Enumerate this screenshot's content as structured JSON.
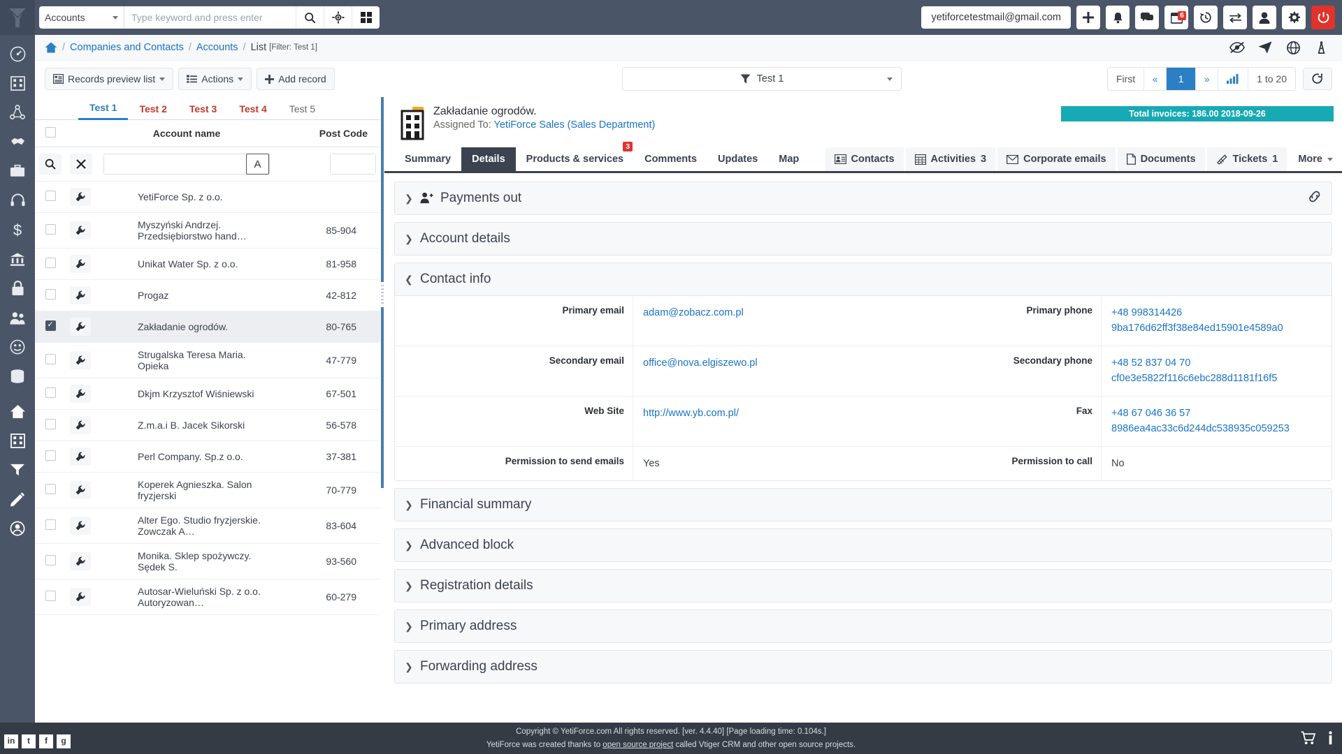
{
  "topbar": {
    "module_select": "Accounts",
    "search_placeholder": "Type keyword and press enter",
    "user_email": "yetiforcetestmail@gmail.com",
    "calendar_badge": "6",
    "icons": [
      "search-icon",
      "crosshair-icon",
      "grid-icon",
      "plus-icon",
      "bell-icon",
      "chat-icon",
      "calendar-icon",
      "history-icon",
      "transfer-icon",
      "user-icon",
      "gear-icon",
      "power-icon"
    ]
  },
  "breadcrumb": {
    "home": "⌂",
    "items": [
      "Companies and Contacts",
      "Accounts"
    ],
    "current": "List",
    "filter": "[Filter: Test 1]",
    "actions": [
      "eye-slash-icon",
      "paper-plane-icon",
      "globe-icon",
      "tower-icon"
    ]
  },
  "toolbar": {
    "records_preview": "Records preview list",
    "actions": "Actions",
    "add_record": "Add record",
    "filter_value": "Test 1",
    "pager": {
      "first": "First",
      "prev": "«",
      "page": "1",
      "next": "»",
      "chart_icon": "bar-chart-icon",
      "range": "1 to 20",
      "refresh": "↺"
    }
  },
  "list": {
    "tabs": [
      {
        "label": "Test 1",
        "active": true
      },
      {
        "label": "Test 2",
        "active": false
      },
      {
        "label": "Test 3",
        "active": false
      },
      {
        "label": "Test 4",
        "active": false
      },
      {
        "label": "Test 5",
        "active": false
      }
    ],
    "columns": [
      "Account name",
      "Post Code"
    ],
    "search_row": {
      "name_value": "",
      "code_value": "",
      "alpha_btn": "A"
    },
    "rows": [
      {
        "name": "YetiForce Sp. z o.o.",
        "code": "",
        "selected": false
      },
      {
        "name": "Myszyński Andrzej. Przedsiębiorstwo hand…",
        "code": "85-904",
        "selected": false
      },
      {
        "name": "Unikat Water Sp. z o.o.",
        "code": "81-958",
        "selected": false
      },
      {
        "name": "Progaz",
        "code": "42-812",
        "selected": false
      },
      {
        "name": "Zakładanie ogrodów.",
        "code": "80-765",
        "selected": true
      },
      {
        "name": "Strugalska Teresa Maria. Opieka",
        "code": "47-779",
        "selected": false
      },
      {
        "name": "Dkjm Krzysztof Wiśniewski",
        "code": "67-501",
        "selected": false
      },
      {
        "name": "Z.m.a.i B. Jacek Sikorski",
        "code": "56-578",
        "selected": false
      },
      {
        "name": "Perl Company. Sp.z o.o.",
        "code": "37-381",
        "selected": false
      },
      {
        "name": "Koperek Agnieszka. Salon fryzjerski",
        "code": "70-779",
        "selected": false
      },
      {
        "name": "Alter Ego. Studio fryzjerskie. Zowczak A…",
        "code": "83-604",
        "selected": false
      },
      {
        "name": "Monika. Sklep spożywczy. Sędek S.",
        "code": "93-560",
        "selected": false
      },
      {
        "name": "Autosar-Wieluński Sp. z o.o. Autoryzowan…",
        "code": "60-279",
        "selected": false
      }
    ]
  },
  "record": {
    "title": "Zakładanie ogrodów.",
    "assigned_label": "Assigned To:",
    "assigned_to": "YetiForce Sales (Sales Department)",
    "invoice_badge": "Total invoices: 186.00 2018-09-26",
    "tabs_left": [
      {
        "label": "Summary",
        "active": false,
        "badge": ""
      },
      {
        "label": "Details",
        "active": true,
        "badge": ""
      },
      {
        "label": "Products & services",
        "active": false,
        "badge": "3"
      },
      {
        "label": "Comments",
        "active": false,
        "badge": ""
      },
      {
        "label": "Updates",
        "active": false,
        "badge": ""
      },
      {
        "label": "Map",
        "active": false,
        "badge": ""
      }
    ],
    "tabs_right": [
      {
        "label": "Contacts",
        "icon": "contact-card-icon",
        "badge": ""
      },
      {
        "label": "Activities",
        "icon": "calendar-grid-icon",
        "badge": "3"
      },
      {
        "label": "Corporate emails",
        "icon": "envelope-icon",
        "badge": ""
      },
      {
        "label": "Documents",
        "icon": "document-icon",
        "badge": ""
      },
      {
        "label": "Tickets",
        "icon": "ticket-icon",
        "badge": "1"
      },
      {
        "label": "More",
        "icon": "caret-down-icon",
        "badge": ""
      }
    ]
  },
  "blocks": [
    {
      "title": "Payments out",
      "expanded": false,
      "has_icon": true,
      "has_link": true
    },
    {
      "title": "Account details",
      "expanded": false,
      "has_icon": false,
      "has_link": false
    },
    {
      "title": "Contact info",
      "expanded": true,
      "has_icon": false,
      "has_link": false
    },
    {
      "title": "Financial summary",
      "expanded": false,
      "has_icon": false,
      "has_link": false
    },
    {
      "title": "Advanced block",
      "expanded": false,
      "has_icon": false,
      "has_link": false
    },
    {
      "title": "Registration details",
      "expanded": false,
      "has_icon": false,
      "has_link": false
    },
    {
      "title": "Primary address",
      "expanded": false,
      "has_icon": false,
      "has_link": false
    },
    {
      "title": "Forwarding address",
      "expanded": false,
      "has_icon": false,
      "has_link": false
    }
  ],
  "contact_info": {
    "rows": [
      {
        "left_label": "Primary email",
        "left_value": "adam@zobacz.com.pl",
        "left_link": true,
        "left_value2": "",
        "right_label": "Primary phone",
        "right_value": "+48 998314426",
        "right_link": true,
        "right_value2": "9ba176d62ff3f38e84ed15901e4589a0"
      },
      {
        "left_label": "Secondary email",
        "left_value": "office@nova.elgiszewo.pl",
        "left_link": true,
        "left_value2": "",
        "right_label": "Secondary phone",
        "right_value": "+48 52 837 04 70",
        "right_link": true,
        "right_value2": "cf0e3e5822f116c6ebc288d1181f16f5"
      },
      {
        "left_label": "Web Site",
        "left_value": "http://www.yb.com.pl/",
        "left_link": true,
        "left_value2": "",
        "right_label": "Fax",
        "right_value": "+48 67 046 36 57",
        "right_link": true,
        "right_value2": "8986ea4ac33c6d244dc538935c059253"
      },
      {
        "left_label": "Permission to send emails",
        "left_value": "Yes",
        "left_link": false,
        "left_value2": "",
        "right_label": "Permission to call",
        "right_value": "No",
        "right_link": false,
        "right_value2": ""
      }
    ]
  },
  "footer": {
    "line1": "Copyright © YetiForce.com All rights reserved. [ver. 4.4.40] [Page loading time: 0.104s.]",
    "line2_pre": "YetiForce was created thanks to ",
    "line2_link": "open source project",
    "line2_post": " called Vtiger CRM and other open source projects.",
    "social": [
      "linkedin-icon",
      "twitter-icon",
      "facebook-icon",
      "github-icon"
    ],
    "right_icons": [
      "cart-icon",
      "info-icon"
    ]
  },
  "colors": {
    "topbar": "#4a5568",
    "accent": "#2b7fc4",
    "badge_red": "#e0332c",
    "teal": "#18aab4",
    "footer": "#353b45"
  }
}
